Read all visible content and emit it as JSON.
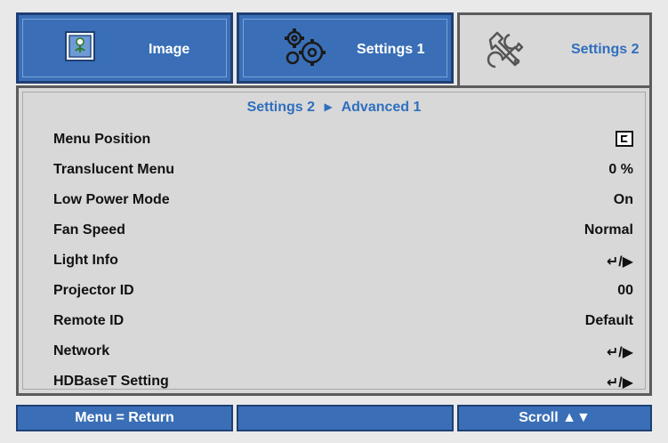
{
  "tabs": [
    {
      "label": "Image",
      "icon": "image-icon",
      "active": false
    },
    {
      "label": "Settings 1",
      "icon": "gears-icon",
      "active": false
    },
    {
      "label": "Settings 2",
      "icon": "tools-icon",
      "active": true
    }
  ],
  "breadcrumb": {
    "parent": "Settings 2",
    "separator": "▶",
    "current": "Advanced 1"
  },
  "rows": [
    {
      "label": "Menu Position",
      "value": ""
    },
    {
      "label": "Translucent Menu",
      "value": "0 %"
    },
    {
      "label": "Low Power Mode",
      "value": "On"
    },
    {
      "label": "Fan Speed",
      "value": "Normal"
    },
    {
      "label": "Light Info",
      "value": "↵/▶"
    },
    {
      "label": "Projector ID",
      "value": "00"
    },
    {
      "label": "Remote ID",
      "value": "Default"
    },
    {
      "label": "Network",
      "value": "↵/▶"
    },
    {
      "label": "HDBaseT Setting",
      "value": "↵/▶"
    }
  ],
  "footer": {
    "left": "Menu = Return",
    "middle": "",
    "right": "Scroll ▲▼"
  },
  "colors": {
    "accent": "#2f6fbe",
    "tab_blue": "#3a6fb7",
    "panel_gray": "#d8d8d8"
  }
}
